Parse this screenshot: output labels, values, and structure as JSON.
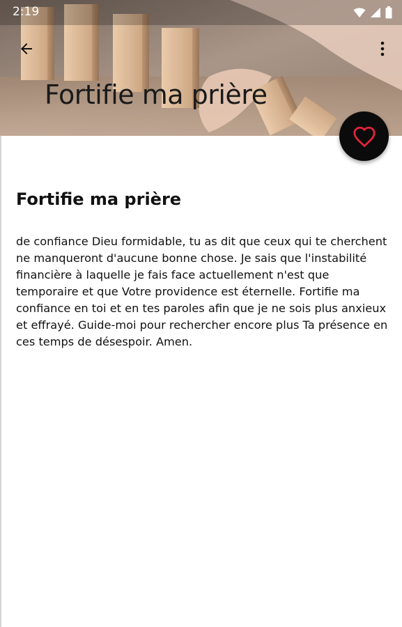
{
  "status_bar": {
    "time": "2:19",
    "icons": [
      "wifi-icon",
      "signal-icon",
      "battery-icon"
    ]
  },
  "toolbar": {
    "back_icon": "arrow-back-icon",
    "more_icon": "more-vertical-icon",
    "title": "Fortifie ma prière"
  },
  "fab": {
    "icon": "heart-outline-icon",
    "icon_color": "#e0243c"
  },
  "content": {
    "title": "Fortifie ma prière",
    "body": "de confiance Dieu formidable, tu as dit que ceux qui te cherchent ne manqueront d'aucune bonne chose. Je sais que l'instabilité financière à laquelle je fais face actuellement n'est que temporaire et que Votre providence est éternelle. Fortifie ma confiance en toi et en tes paroles afin que je ne sois plus anxieux et effrayé. Guide-moi pour rechercher encore plus Ta présence en ces temps de désespoir. Amen."
  },
  "colors": {
    "fab_background": "#0b0b0b",
    "text": "#111111",
    "header_text": "#1a1a1a"
  }
}
